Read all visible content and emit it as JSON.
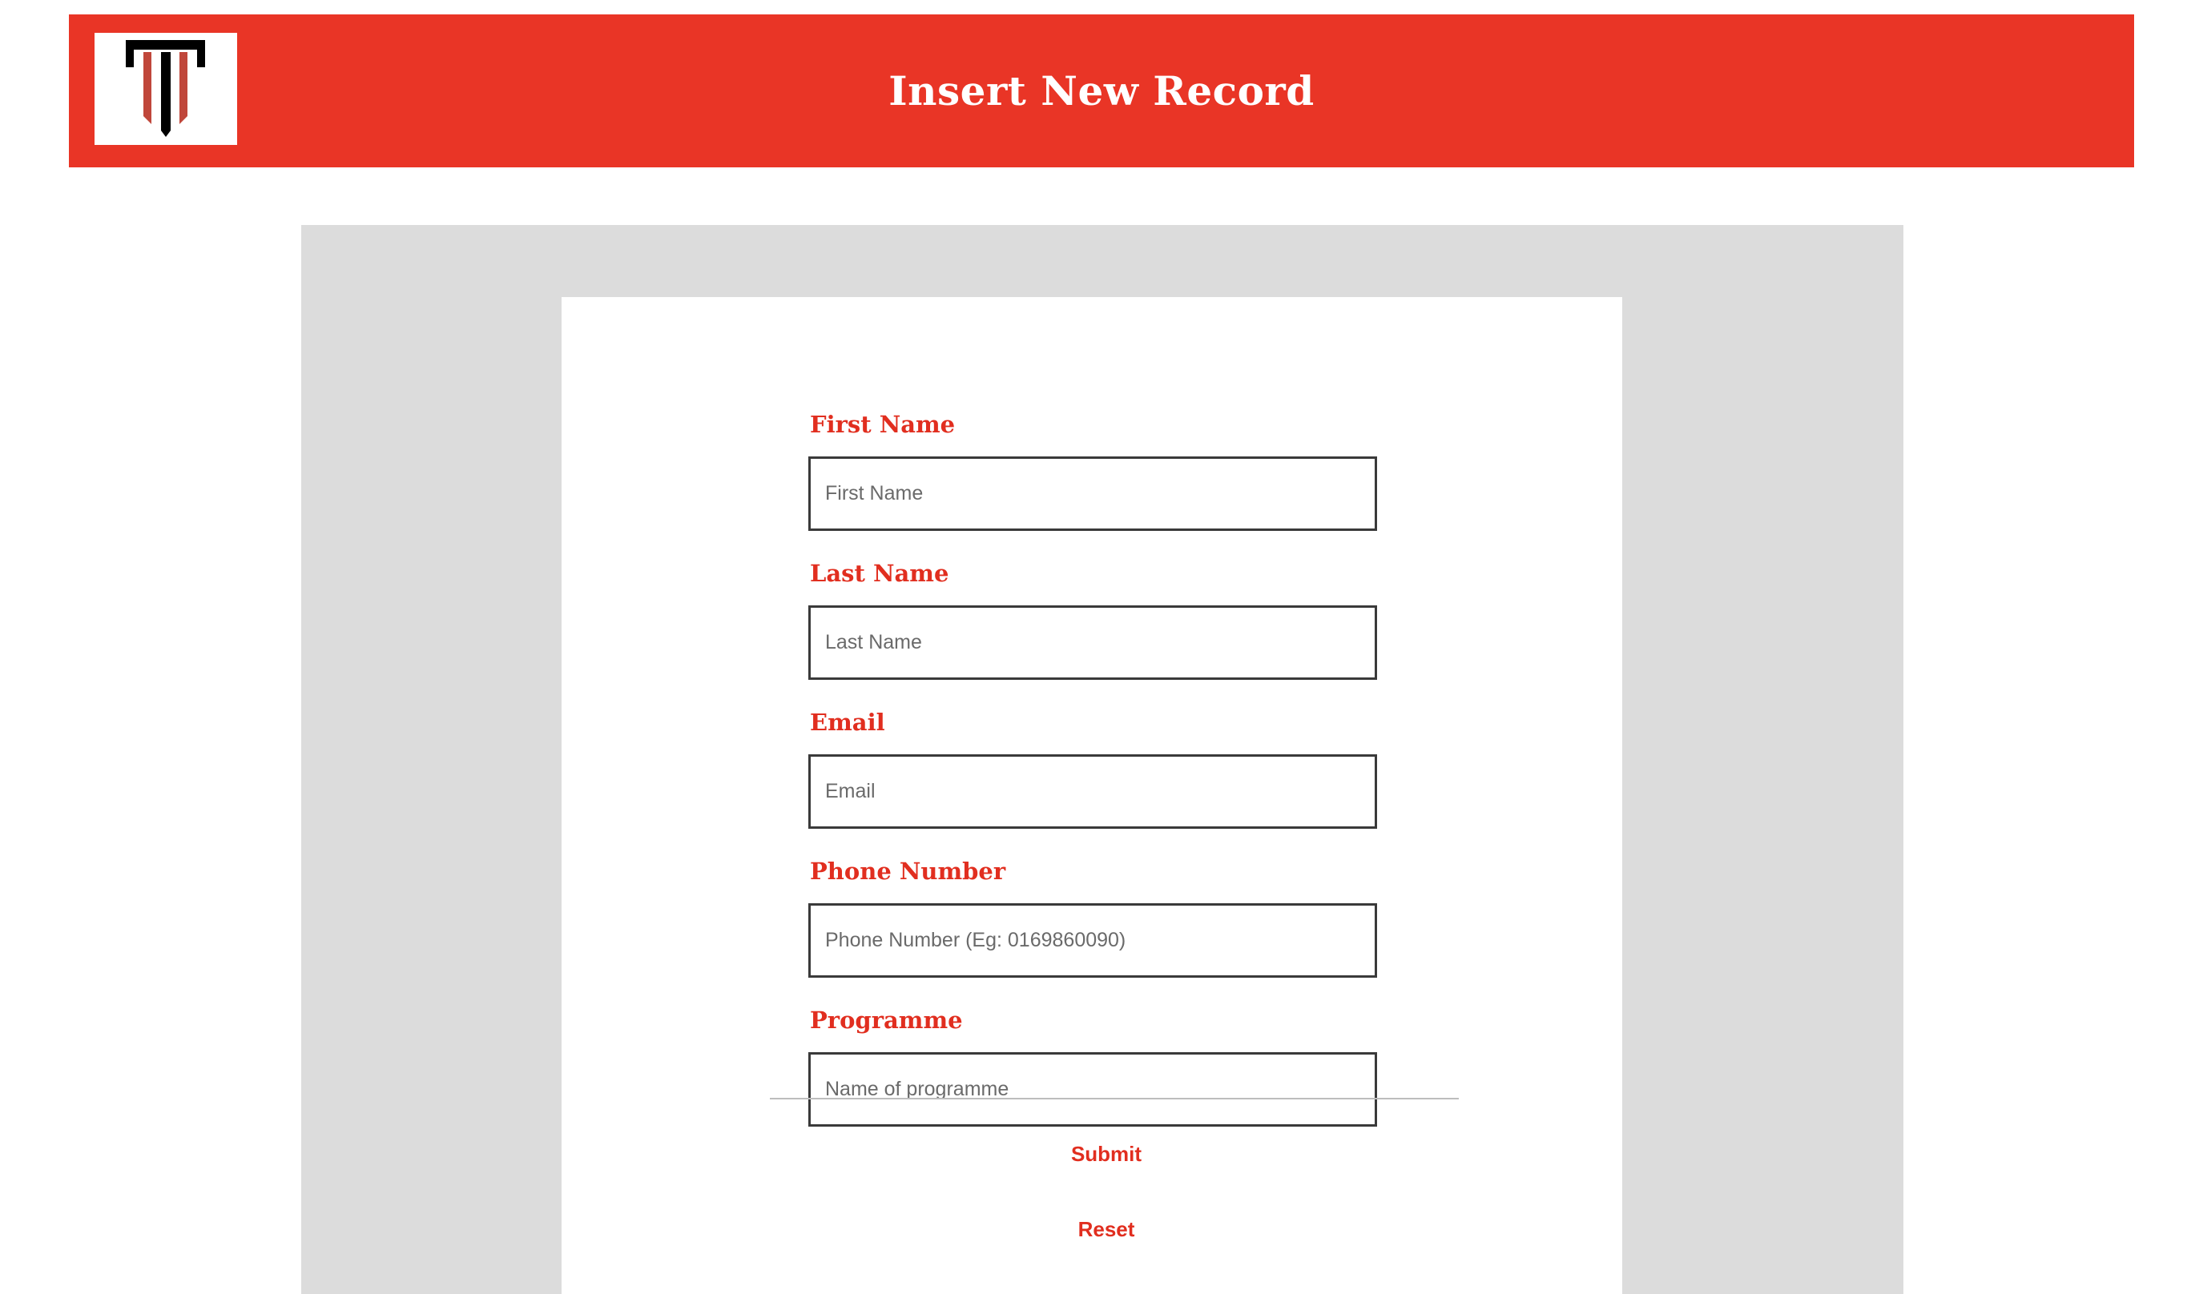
{
  "header": {
    "title": "Insert New Record",
    "logo_icon": "pillar-logo-icon",
    "background_color": "#e93526"
  },
  "form": {
    "fields": [
      {
        "label": "First Name",
        "placeholder": "First Name",
        "value": ""
      },
      {
        "label": "Last Name",
        "placeholder": "Last Name",
        "value": ""
      },
      {
        "label": "Email",
        "placeholder": "Email",
        "value": ""
      },
      {
        "label": "Phone Number",
        "placeholder": "Phone Number (Eg: 0169860090)",
        "value": ""
      },
      {
        "label": "Programme",
        "placeholder": "Name of programme",
        "value": ""
      }
    ],
    "submit_label": "Submit",
    "reset_label": "Reset"
  },
  "colors": {
    "accent": "#e12e1f",
    "panel_background": "#dcdcdc"
  }
}
